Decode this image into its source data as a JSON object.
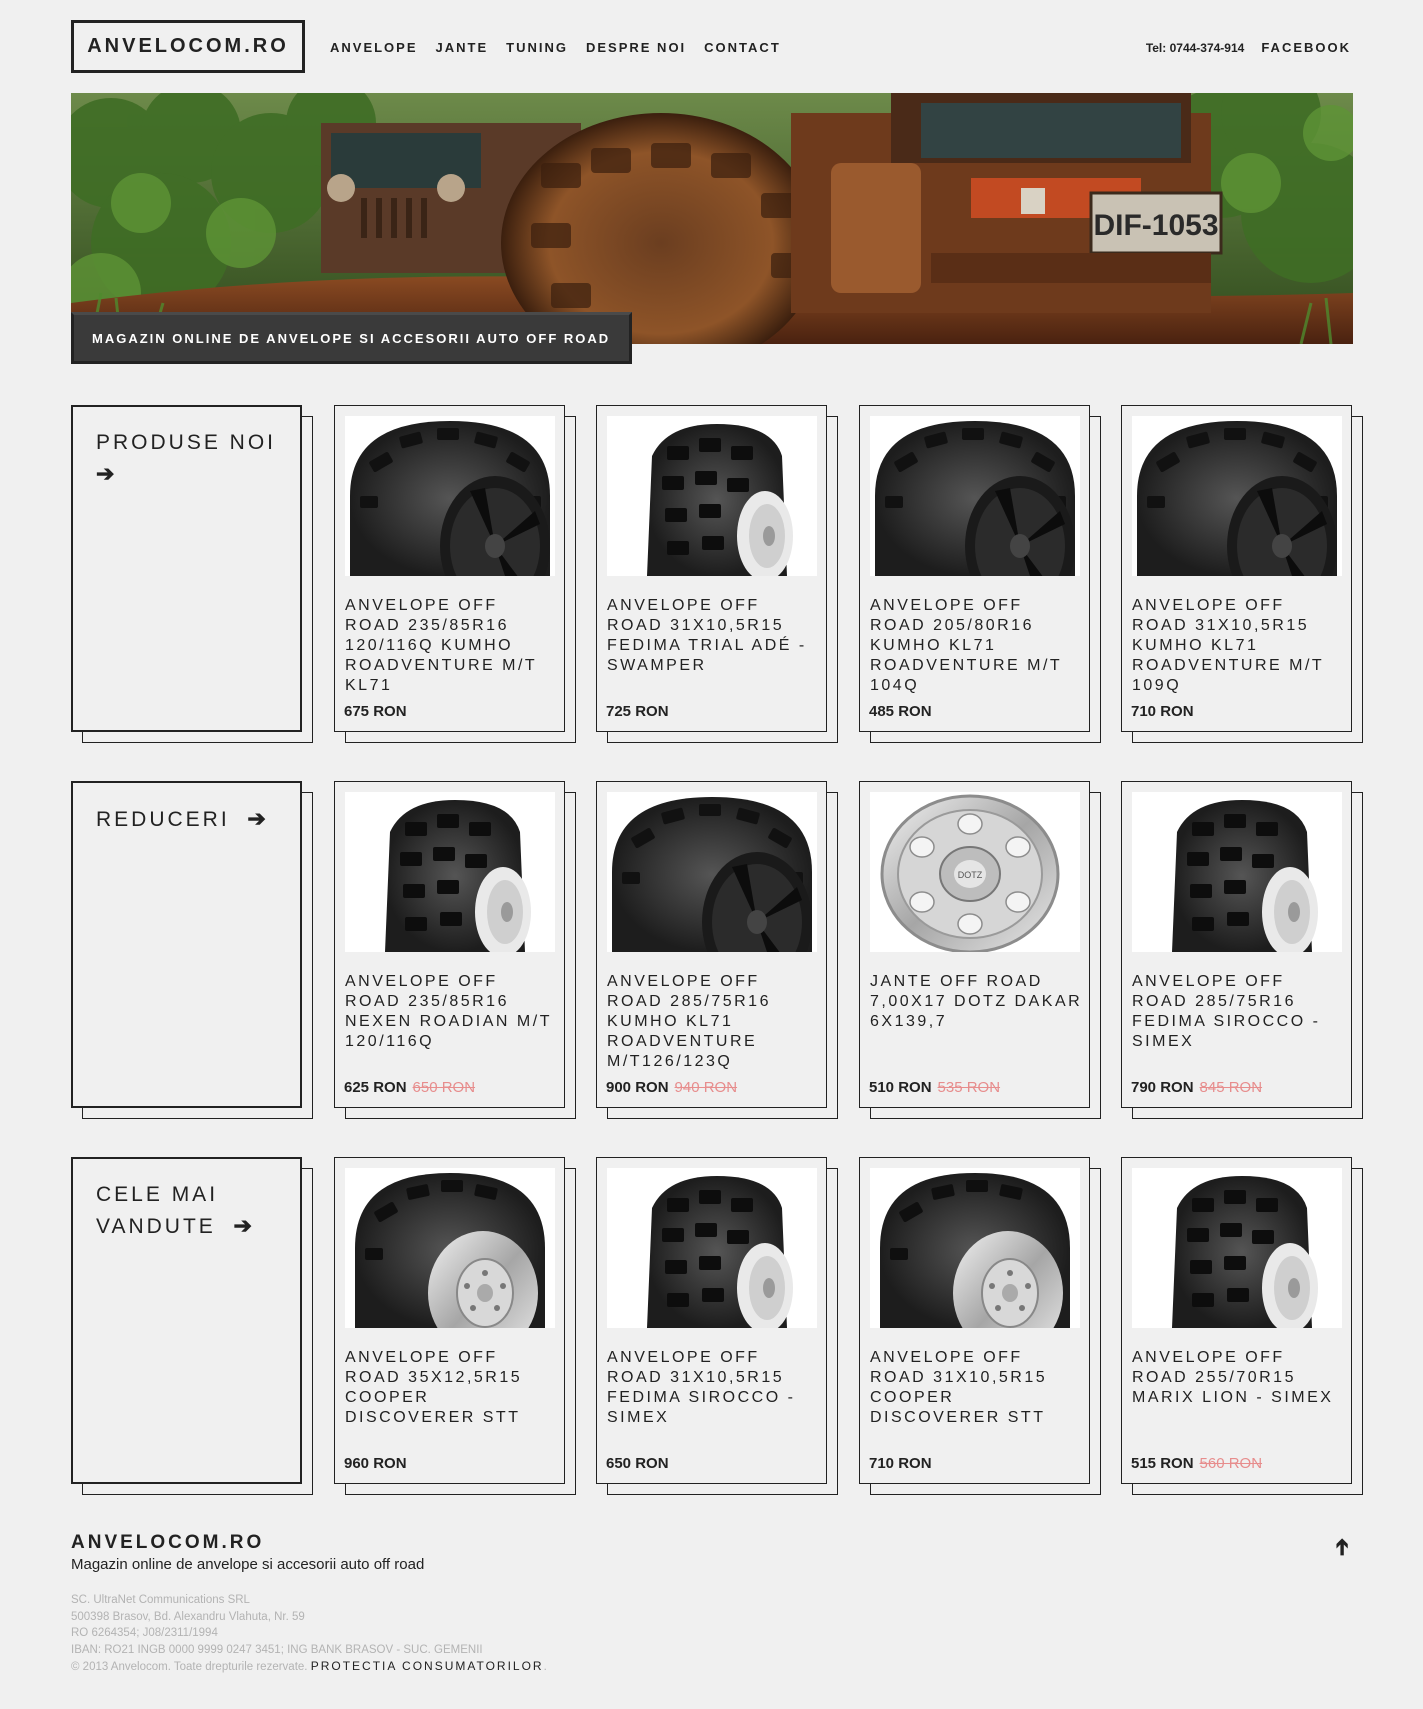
{
  "header": {
    "logo": "ANVELOCOM.RO",
    "nav": [
      "ANVELOPE",
      "JANTE",
      "TUNING",
      "DESPRE NOI",
      "CONTACT"
    ],
    "phone": "Tel: 0744-374-914",
    "facebook": "FACEBOOK"
  },
  "hero": {
    "caption": "MAGAZIN ONLINE DE ANVELOPE SI ACCESORII AUTO OFF ROAD",
    "plate": "DIF-1053"
  },
  "sections": [
    {
      "title_lines": [
        "PRODUSE NOI"
      ],
      "arrow": "➔",
      "products": [
        {
          "name": "ANVELOPE OFF ROAD 235/85R16 120/116Q KUMHO ROADVENTURE M/T KL71",
          "price": "675 RON",
          "old_price": "",
          "image": "tire-rim-icon"
        },
        {
          "name": "ANVELOPE OFF ROAD 31X10,5R15 FEDIMA TRIAL ADÉ - SWAMPER",
          "price": "725 RON",
          "old_price": "",
          "image": "tire-tall-icon"
        },
        {
          "name": "ANVELOPE OFF ROAD 205/80R16 KUMHO KL71 ROADVENTURE M/T 104Q",
          "price": "485 RON",
          "old_price": "",
          "image": "tire-rim-icon"
        },
        {
          "name": "ANVELOPE OFF ROAD 31X10,5R15 KUMHO KL71 ROADVENTURE M/T 109Q",
          "price": "710 RON",
          "old_price": "",
          "image": "tire-rim-icon"
        }
      ]
    },
    {
      "title_lines": [
        "REDUCERI"
      ],
      "arrow": "➔",
      "products": [
        {
          "name": "ANVELOPE OFF ROAD 235/85R16 NEXEN ROADIAN M/T 120/116Q",
          "price": "625 RON",
          "old_price": "650 RON",
          "image": "tire-tall-icon"
        },
        {
          "name": "ANVELOPE OFF ROAD 285/75R16 KUMHO KL71 ROADVENTURE M/T126/123Q",
          "price": "900 RON",
          "old_price": "940 RON",
          "image": "tire-rim-icon"
        },
        {
          "name": "JANTE OFF ROAD 7,00X17 DOTZ DAKAR 6X139,7",
          "price": "510 RON",
          "old_price": "535 RON",
          "image": "wheel-rim-icon"
        },
        {
          "name": "ANVELOPE OFF ROAD 285/75R16 FEDIMA SIROCCO - SIMEX",
          "price": "790 RON",
          "old_price": "845 RON",
          "image": "tire-tall-icon"
        }
      ]
    },
    {
      "title_lines": [
        "CELE MAI",
        "VANDUTE"
      ],
      "arrow": "➔",
      "products": [
        {
          "name": "ANVELOPE OFF ROAD 35X12,5R15 COOPER DISCOVERER STT",
          "price": "960 RON",
          "old_price": "",
          "image": "tire-rim-icon"
        },
        {
          "name": "ANVELOPE OFF ROAD 31X10,5R15 FEDIMA SIROCCO - SIMEX",
          "price": "650 RON",
          "old_price": "",
          "image": "tire-tall-icon"
        },
        {
          "name": "ANVELOPE OFF ROAD 31X10,5R15 COOPER DISCOVERER STT",
          "price": "710 RON",
          "old_price": "",
          "image": "tire-rim-icon"
        },
        {
          "name": "ANVELOPE OFF ROAD 255/70R15 MARIX LION - SIMEX",
          "price": "515 RON",
          "old_price": "560 RON",
          "image": "tire-tall-icon"
        }
      ]
    }
  ],
  "footer": {
    "brand": "ANVELOCOM.RO",
    "tagline": "Magazin online de anvelope si accesorii auto off road",
    "up_arrow": "➔",
    "company": "SC. UltraNet Communications SRL",
    "address": "500398 Brasov, Bd. Alexandru Vlahuta, Nr. 59",
    "registration": "RO 6264354; J08/2311/1994",
    "iban": "IBAN: RO21 INGB 0000 9999 0247 3451; ING BANK BRASOV - SUC. GEMENII",
    "copyright": "© 2013 Anvelocom. Toate drepturile rezervate.",
    "protection_link": "PROTECTIA CONSUMATORILOR",
    "period": "."
  },
  "colors": {
    "background": "#f0f0f0",
    "text": "#222222",
    "old_price": "#e78d8d",
    "caption_bg": "#3a3a3a",
    "footer_muted": "#b3b3b3"
  }
}
